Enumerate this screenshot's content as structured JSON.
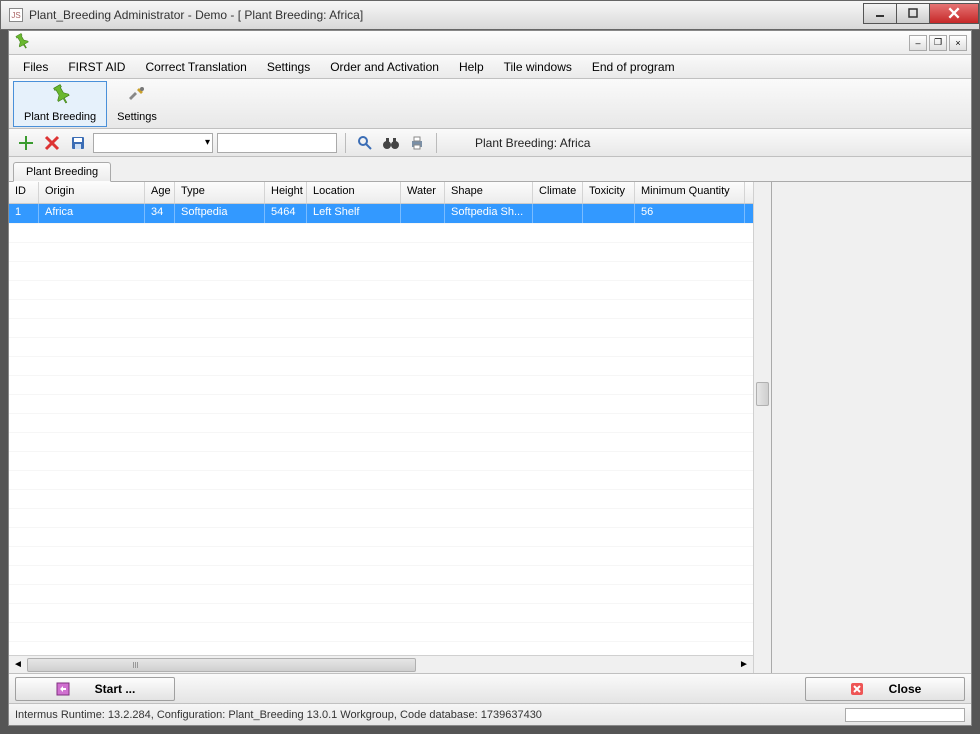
{
  "window": {
    "title": "Plant_Breeding  Administrator - Demo - [     Plant Breeding:  Africa]"
  },
  "menu": {
    "items": [
      "Files",
      "FIRST AID",
      "Correct Translation",
      "Settings",
      "Order and Activation",
      "Help",
      "Tile windows",
      "End of program"
    ]
  },
  "ribbon": {
    "plant_breeding": "Plant Breeding",
    "settings": "Settings"
  },
  "toolbar": {
    "context_label": "Plant Breeding:  Africa"
  },
  "tab": {
    "label": "Plant Breeding"
  },
  "grid": {
    "columns": [
      "ID",
      "Origin",
      "Age",
      "Type",
      "Height",
      "Location",
      "Water",
      "Shape",
      "Climate",
      "Toxicity",
      "Minimum Quantity"
    ],
    "row0": {
      "id": "1",
      "origin": "Africa",
      "age": "34",
      "type": "Softpedia",
      "height": "5464",
      "location": "Left Shelf",
      "water": "",
      "shape": "Softpedia Sh...",
      "climate": "",
      "toxicity": "",
      "minq": "56"
    }
  },
  "actions": {
    "start": "Start ...",
    "close": "Close"
  },
  "status": {
    "text": "Intermus Runtime: 13.2.284, Configuration: Plant_Breeding 13.0.1 Workgroup, Code database: 1739637430"
  }
}
